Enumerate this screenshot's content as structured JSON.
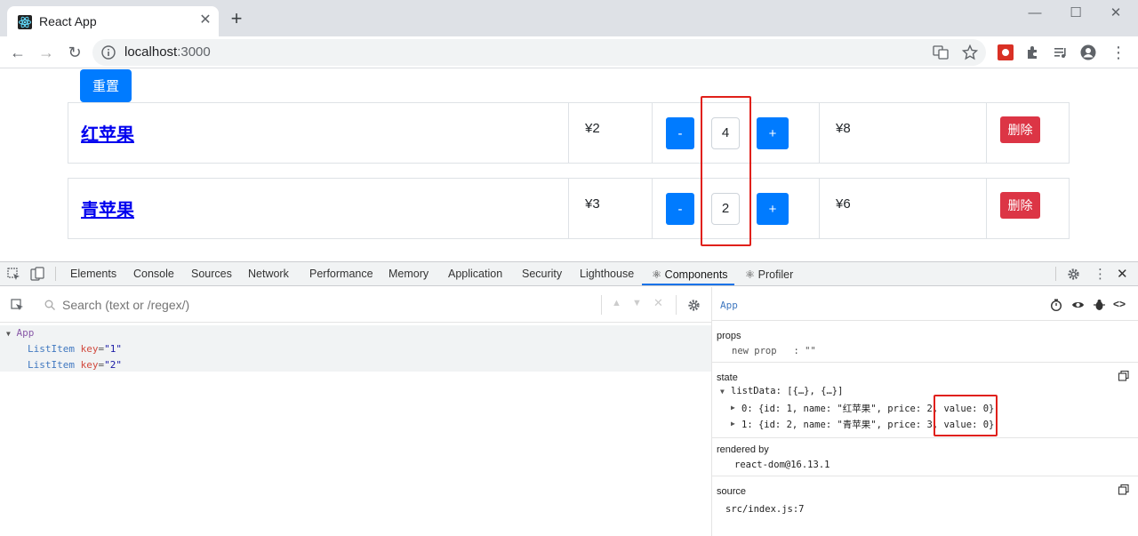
{
  "browser": {
    "tab_title": "React App",
    "url_host": "localhost",
    "url_port": ":3000"
  },
  "page": {
    "reset_label": "重置",
    "rows": [
      {
        "name": "红苹果",
        "price": "¥2",
        "minus": "-",
        "qty": "4",
        "plus": "+",
        "total": "¥8",
        "delete": "删除"
      },
      {
        "name": "青苹果",
        "price": "¥3",
        "minus": "-",
        "qty": "2",
        "plus": "+",
        "total": "¥6",
        "delete": "删除"
      }
    ]
  },
  "devtools": {
    "tabs": [
      "Elements",
      "Console",
      "Sources",
      "Network",
      "Performance",
      "Memory",
      "Application",
      "Security",
      "Lighthouse",
      "⚛ Components",
      "⚛ Profiler"
    ],
    "active_tab": "⚛ Components",
    "search_placeholder": "Search (text or /regex/)",
    "tree": {
      "root": "App",
      "children": [
        {
          "tag": "ListItem",
          "attr": "key",
          "value": "\"1\""
        },
        {
          "tag": "ListItem",
          "attr": "key",
          "value": "\"2\""
        }
      ]
    },
    "inspector": {
      "component": "App",
      "props_title": "props",
      "props_line": "new prop   : \"\"",
      "state_title": "state",
      "state_line0": "listData: [{…}, {…}]",
      "state_item0": "0: {id: 1, name: \"红苹果\", price: 2, value: 0}",
      "state_item1": "1: {id: 2, name: \"青苹果\", price: 3, value: 0}",
      "rendered_title": "rendered by",
      "rendered_value": "react-dom@16.13.1",
      "source_title": "source",
      "source_value": "src/index.js:7"
    }
  },
  "colors": {
    "primary": "#007bff",
    "danger": "#dc3545",
    "highlight": "#e0201a",
    "link": "#0000ee"
  }
}
